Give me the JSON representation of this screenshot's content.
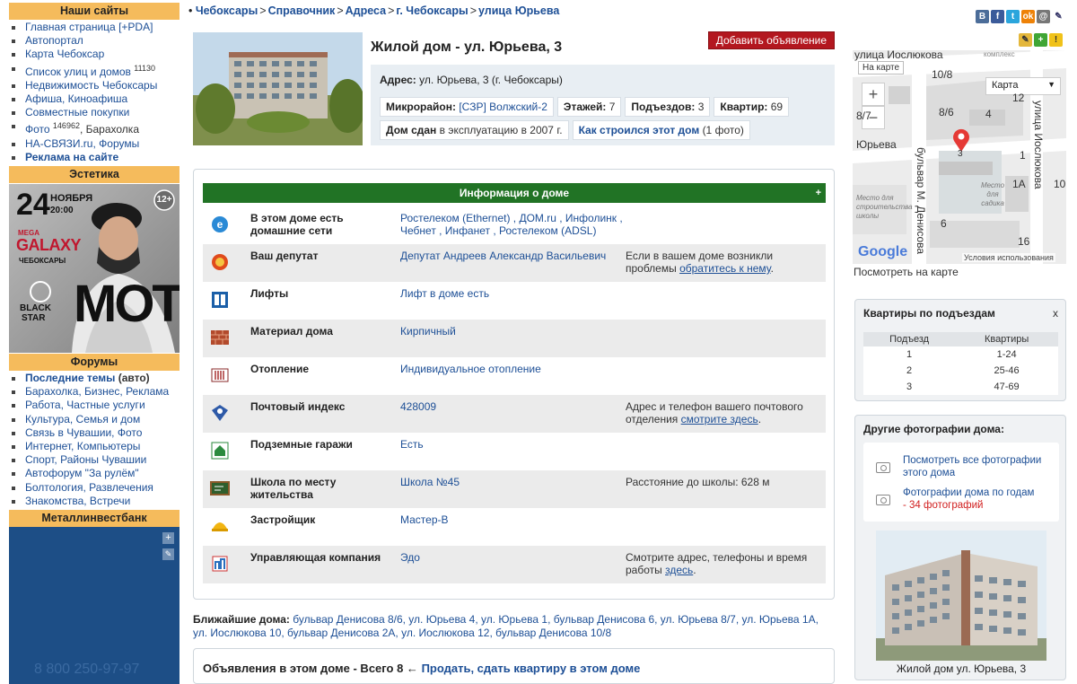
{
  "left": {
    "sites_title": "Наши сайты",
    "sites": [
      {
        "label": "Главная страница [+PDA]"
      },
      {
        "label": "Автопортал"
      },
      {
        "label": "Карта Чебоксар"
      },
      {
        "label": "Список улиц и домов",
        "sup": "11130"
      },
      {
        "label": "Недвижимость Чебоксары"
      },
      {
        "label": "Афиша, Киноафиша"
      },
      {
        "label": "Совместные покупки"
      },
      {
        "label": "Фото",
        "sup": "146962",
        "tail": ", Барахолка"
      },
      {
        "label": "НА-СВЯЗИ.ru, Форумы"
      },
      {
        "label": "Реклама на сайте",
        "bold": true
      }
    ],
    "aesthetics_title": "Эстетика",
    "banner": {
      "day": "24",
      "month": "НОЯБРЯ",
      "time": "20:00",
      "age": "12+",
      "mega": "MEGA",
      "galaxy": "GALAXY",
      "city": "ЧЕБОКСАРЫ",
      "label1": "BLACK",
      "label2": "STAR",
      "artist": "MOT"
    },
    "forums_title": "Форумы",
    "forums": [
      {
        "label": "Последние темы",
        "tail": " (авто)",
        "bold": true
      },
      {
        "label": "Барахолка, Бизнес, Реклама"
      },
      {
        "label": "Работа, Частные услуги"
      },
      {
        "label": "Культура, Семья и дом"
      },
      {
        "label": "Связь в Чувашии, Фото"
      },
      {
        "label": "Интернет, Компьютеры"
      },
      {
        "label": "Спорт, Районы Чувашии"
      },
      {
        "label": "Автофорум \"За рулём\""
      },
      {
        "label": "Болтология, Развлечения"
      },
      {
        "label": "Знакомства, Встречи"
      }
    ],
    "bank_title": "Металлинвестбанк",
    "bank_phone": "8 800 250-97-97"
  },
  "breadcrumb": [
    {
      "label": "Чебоксары"
    },
    {
      "label": "Справочник"
    },
    {
      "label": "Адреса"
    },
    {
      "label": "г. Чебоксары"
    },
    {
      "label": "улица Юрьева"
    }
  ],
  "house": {
    "title": "Жилой дом - ул. Юрьева, 3",
    "add_ad_label": "Добавить объявление",
    "address_label": "Адрес:",
    "address_value": "ул. Юрьева, 3 (г. Чебоксары)",
    "district_label": "Микрорайон:",
    "district_value": "[СЗР] Волжский-2",
    "floors_label": "Этажей:",
    "floors_value": "7",
    "entrances_label": "Подъездов:",
    "entrances_value": "3",
    "flats_label": "Квартир:",
    "flats_value": "69",
    "built_label": "Дом сдан",
    "built_value": "в эксплуатацию в 2007 г.",
    "history_label": "Как строился этот дом",
    "history_value": "(1 фото)"
  },
  "info": {
    "title": "Информация о доме",
    "plus": "+",
    "rows": [
      {
        "icon": "internet-explorer-icon",
        "label": "В этом доме есть домашние сети",
        "value": "Ростелеком (Ethernet) , ДОМ.ru , Инфолинк , Чебнет , Инфанет , Ростелеком (ADSL)",
        "note": "",
        "note_link": "",
        "note_tail": ""
      },
      {
        "icon": "deputy-emblem-icon",
        "label": "Ваш депутат",
        "value": "Депутат Андреев Александр Васильевич",
        "note": "Если в вашем доме возникли проблемы ",
        "note_link": "обратитесь к нему",
        "note_tail": "."
      },
      {
        "icon": "elevator-icon",
        "label": "Лифты",
        "value": "Лифт в доме есть",
        "note": "",
        "note_link": "",
        "note_tail": ""
      },
      {
        "icon": "brick-wall-icon",
        "label": "Материал дома",
        "value": "Кирпичный",
        "note": "",
        "note_link": "",
        "note_tail": ""
      },
      {
        "icon": "radiator-icon",
        "label": "Отопление",
        "value": "Индивидуальное отопление",
        "note": "",
        "note_link": "",
        "note_tail": ""
      },
      {
        "icon": "post-emblem-icon",
        "label": "Почтовый индекс",
        "value": "428009",
        "note": "Адрес и телефон вашего почтового отделения ",
        "note_link": "смотрите здесь",
        "note_tail": "."
      },
      {
        "icon": "garage-icon",
        "label": "Подземные гаражи",
        "value": "Есть",
        "note": "",
        "note_link": "",
        "note_tail": ""
      },
      {
        "icon": "school-board-icon",
        "label": "Школа по месту жительства",
        "value": "Школа №45",
        "note": "Расстояние до школы: 628 м",
        "note_link": "",
        "note_tail": ""
      },
      {
        "icon": "builder-helmet-icon",
        "label": "Застройщик",
        "value": "Мастер-В",
        "note": "",
        "note_link": "",
        "note_tail": ""
      },
      {
        "icon": "management-company-icon",
        "label": "Управляющая компания",
        "value": "Эдо",
        "note": "Смотрите адрес, телефоны и время работы ",
        "note_link": "здесь",
        "note_tail": "."
      }
    ]
  },
  "nearby": {
    "label": "Ближайшие дома:",
    "items": "бульвар Денисова 8/6, ул. Юрьева 4, ул. Юрьева 1, бульвар Денисова 6, ул. Юрьева 8/7, ул. Юрьева 1А, ул. Иослюкова 10, бульвар Денисова 2А, ул. Иослюкова 12, бульвар Денисова 10/8"
  },
  "ads": {
    "text": "Объявления в этом доме - Всего 8 ←",
    "link": "Продать, сдать квартиру в этом доме"
  },
  "social": [
    "В",
    "f",
    "t",
    "ok",
    "@",
    "✎"
  ],
  "map": {
    "on_map_button": "На карте",
    "type_select": "Карта",
    "zoom_in": "+",
    "zoom_out": "−",
    "labels": {
      "street_top": "улица Иослюкова",
      "street_right": "улица Иослюкова",
      "street_left": "Юрьева",
      "boulevard": "бульвар М. Денисова",
      "n108": "10/8",
      "n86": "8/6",
      "n87": "8/7",
      "n4": "4",
      "n12": "12",
      "n1": "1",
      "n1a": "1А",
      "n10": "10",
      "n3": "3",
      "n6": "6",
      "n16": "16",
      "sport_place": "Место для строительства школы",
      "garden_place": "Место для садика",
      "complex": "комплекс",
      "google": "Google",
      "terms": "Условия использования"
    },
    "link": "Посмотреть на карте"
  },
  "apartments": {
    "title": "Квартиры по подъездам",
    "close": "x",
    "headers": [
      "Подъезд",
      "Квартиры"
    ],
    "rows": [
      [
        "1",
        "1-24"
      ],
      [
        "2",
        "25-46"
      ],
      [
        "3",
        "47-69"
      ]
    ]
  },
  "photos": {
    "title": "Другие фотографии дома:",
    "link1": "Посмотреть все фотографии этого дома",
    "link2": "Фотографии дома по годам",
    "link2_count": "- 34 фотографий",
    "caption": "Жилой дом ул. Юрьева, 3"
  }
}
